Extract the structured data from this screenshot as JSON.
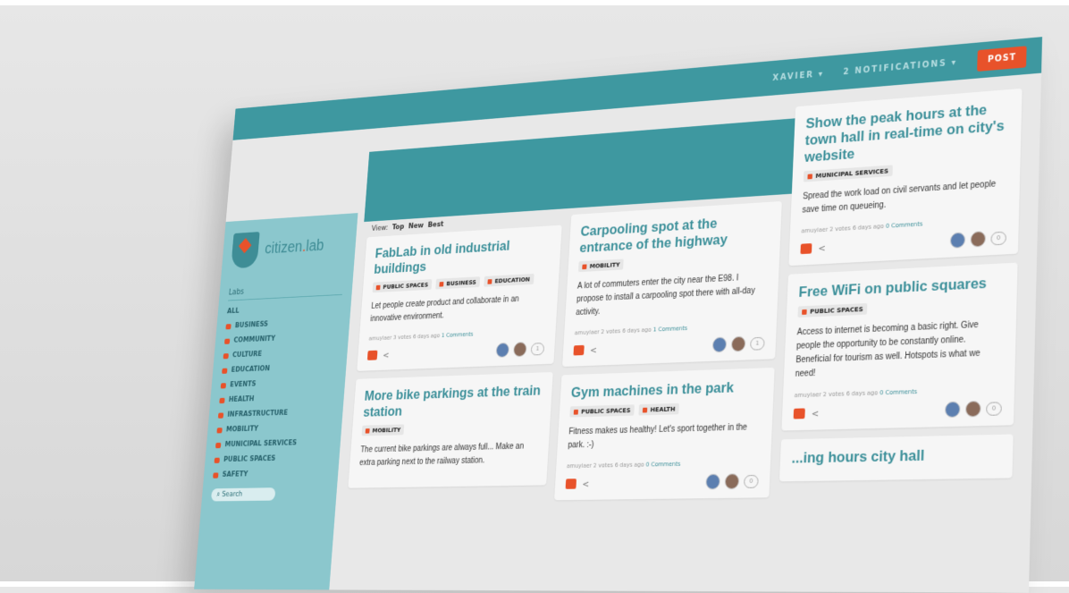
{
  "topbar": {
    "user": "XAVIER ▾",
    "notifications": "2 NOTIFICATIONS ▾",
    "post": "POST"
  },
  "sidebar": {
    "logo": {
      "brand_a": "citizen",
      "dot": ".",
      "brand_b": "lab"
    },
    "labs_title": "Labs",
    "items": [
      "ALL",
      "BUSINESS",
      "COMMUNITY",
      "CULTURE",
      "EDUCATION",
      "EVENTS",
      "HEALTH",
      "INFRASTRUCTURE",
      "MOBILITY",
      "MUNICIPAL SERVICES",
      "PUBLIC SPACES",
      "SAFETY"
    ],
    "search_placeholder": "Search"
  },
  "view": {
    "label": "View:",
    "options": [
      "Top",
      "New",
      "Best"
    ]
  },
  "columns": [
    [
      {
        "title": "FabLab in old industrial buildings",
        "tags": [
          "PUBLIC SPACES",
          "BUSINESS",
          "EDUCATION"
        ],
        "body": "Let people create product and collaborate in an innovative environment.",
        "author": "amuylaer",
        "votes": "3 votes",
        "age": "6 days ago",
        "comments": "1 Comments",
        "count": "1"
      },
      {
        "title": "More bike parkings at the train station",
        "tags": [
          "MOBILITY"
        ],
        "body": "The current bike parkings are always full... Make an extra parking next to the railway station.",
        "author": "",
        "votes": "",
        "age": "",
        "comments": "",
        "count": ""
      }
    ],
    [
      {
        "title": "Carpooling spot at the entrance of the highway",
        "tags": [
          "MOBILITY"
        ],
        "body": "A lot of commuters enter the city near the E98. I propose to install a carpooling spot there with all-day activity.",
        "author": "amuylaer",
        "votes": "2 votes",
        "age": "6 days ago",
        "comments": "1 Comments",
        "count": "1"
      },
      {
        "title": "Gym machines in the park",
        "tags": [
          "PUBLIC SPACES",
          "HEALTH"
        ],
        "body": "Fitness makes us healthy! Let's sport together in the park. :-)",
        "author": "amuylaer",
        "votes": "2 votes",
        "age": "6 days ago",
        "comments": "0 Comments",
        "count": "0"
      }
    ],
    [
      {
        "title": "Show the peak hours at the town hall in real-time on city's website",
        "tags": [
          "MUNICIPAL SERVICES"
        ],
        "body": "Spread the work load on civil servants and let people save time on queueing.",
        "author": "amuylaer",
        "votes": "2 votes",
        "age": "6 days ago",
        "comments": "0 Comments",
        "count": "0"
      },
      {
        "title": "Free WiFi on public squares",
        "tags": [
          "PUBLIC SPACES"
        ],
        "body": "Access to internet is becoming a basic right. Give people the opportunity to be constantly online. Beneficial for tourism as well. Hotspots is what we need!",
        "author": "amuylaer",
        "votes": "2 votes",
        "age": "6 days ago",
        "comments": "0 Comments",
        "count": "0"
      },
      {
        "title": "...ing hours city hall",
        "tags": [],
        "body": "",
        "author": "",
        "votes": "",
        "age": "",
        "comments": "",
        "count": ""
      }
    ]
  ]
}
